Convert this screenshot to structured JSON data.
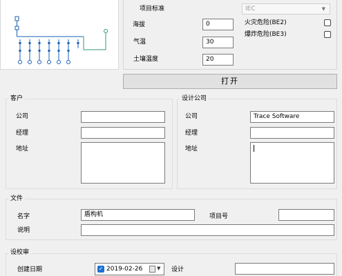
{
  "project": {
    "standard_label": "项目标准",
    "standard_value": "IEC",
    "altitude_label": "海拔",
    "altitude_value": "0",
    "temperature_label": "气温",
    "temperature_value": "30",
    "soil_temp_label": "土壤温度",
    "soil_temp_value": "20",
    "fire_hazard_label": "火灾危险(BE2)",
    "fire_hazard_checked": false,
    "explosion_hazard_label": "爆炸危险(BE3)",
    "explosion_hazard_checked": false
  },
  "open_button_label": "打开",
  "client": {
    "title": "客户",
    "company_label": "公司",
    "company_value": "",
    "manager_label": "经理",
    "manager_value": "",
    "address_label": "地址",
    "address_value": ""
  },
  "design_company": {
    "title": "设计公司",
    "company_label": "公司",
    "company_value": "Trace Software",
    "manager_label": "经理",
    "manager_value": "",
    "address_label": "地址",
    "address_value": ""
  },
  "file": {
    "title": "文件",
    "name_label": "名字",
    "name_value": "盾构机",
    "project_no_label": "项目号",
    "project_no_value": "",
    "description_label": "说明",
    "description_value": ""
  },
  "review": {
    "title": "设校审",
    "created_date_label": "创建日期",
    "created_date_value": "2019-02-26",
    "created_date_checked": true,
    "design_label": "设计",
    "design_value": ""
  },
  "colors": {
    "diagram_blue": "#1a5fb4",
    "diagram_green": "#2e9b6a",
    "checkbox_blue": "#1e6fd0"
  }
}
